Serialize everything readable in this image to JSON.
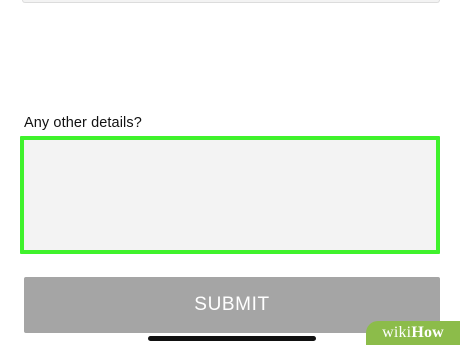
{
  "form": {
    "details_label": "Any other details?",
    "details_value": "",
    "submit_label": "SUBMIT"
  },
  "highlight_color": "#3ff22c",
  "watermark": {
    "part1": "wiki",
    "part2": "How"
  }
}
